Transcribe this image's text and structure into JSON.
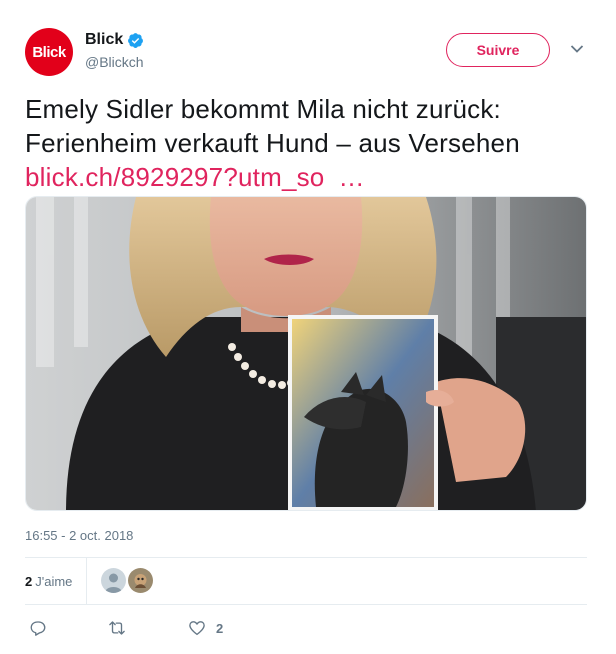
{
  "account": {
    "display_name": "Blick",
    "handle": "@Blickch",
    "avatar_text": "Blick",
    "brand_color": "#e2001a"
  },
  "follow_label": "Suivre",
  "tweet": {
    "line1": "Emely Sidler bekommt Mila nicht zurück:",
    "line2": "Ferienheim verkauft Hund –  aus Versehen",
    "link_text": "blick.ch/8929297?utm_so",
    "link_ellipsis": "…"
  },
  "timestamp": "16:55 - 2 oct. 2018",
  "stats": {
    "likes_count": "2",
    "likes_label": "J'aime"
  },
  "actions": {
    "reply_icon": "reply-icon",
    "retweet_icon": "retweet-icon",
    "like_icon": "heart-icon",
    "like_count": "2"
  },
  "colors": {
    "accent": "#e0245e",
    "muted": "#657786",
    "verified": "#1da1f2"
  }
}
